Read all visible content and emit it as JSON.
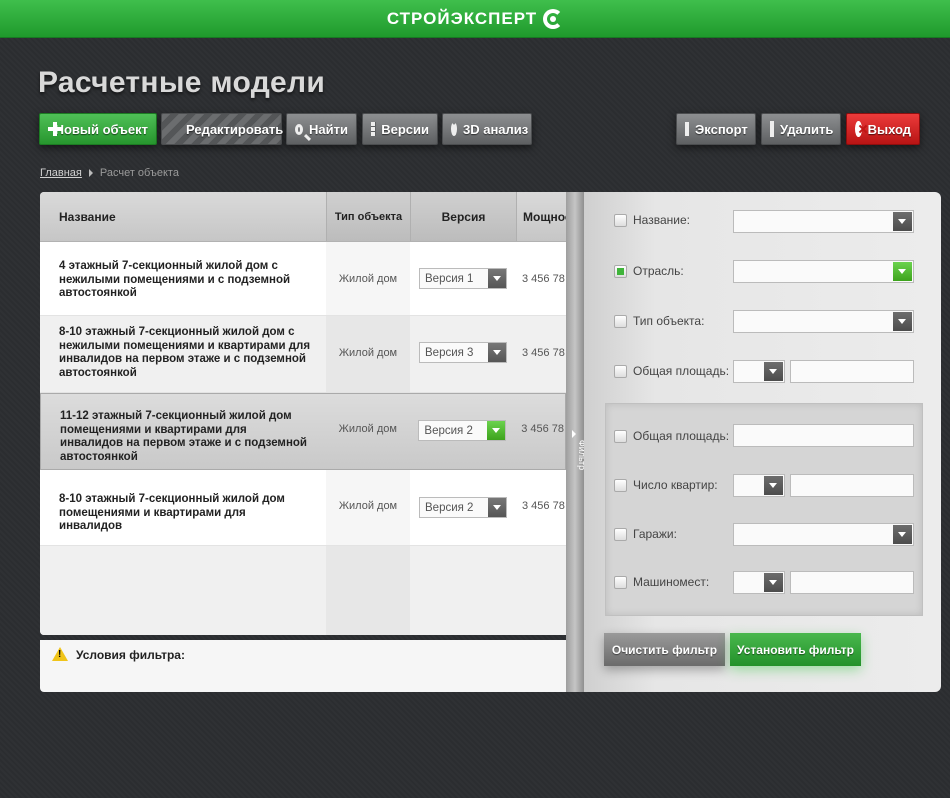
{
  "brand": {
    "name": "СТРОЙЭКСПЕРТ"
  },
  "page": {
    "title": "Расчетные модели"
  },
  "toolbar": {
    "new_object": "Новый объект",
    "edit": "Редактировать",
    "find": "Найти",
    "versions": "Версии",
    "analysis_3d": "3D анализ",
    "export": "Экспорт",
    "delete": "Удалить",
    "exit": "Выход"
  },
  "breadcrumb": {
    "home": "Главная",
    "current": "Расчет объекта"
  },
  "table": {
    "headers": {
      "name": "Название",
      "type": "Тип объекта",
      "version": "Версия",
      "power": "Мощнос"
    },
    "rows": [
      {
        "name": "4 этажный 7-секционный жилой дом с нежилыми помещениями и с подземной автостоянкой",
        "type": "Жилой дом",
        "version": "Версия 1",
        "power": "3 456 78"
      },
      {
        "name": "8-10 этажный 7-секционный жилой дом с нежилыми помещениями и квартирами для инвалидов на первом этаже и с подземной автостоянкой",
        "type": "Жилой дом",
        "version": "Версия 3",
        "power": "3 456 78"
      },
      {
        "name": "11-12 этажный 7-секционный жилой дом помещениями и квартирами для инвалидов на первом этаже и с подземной автостоянкой",
        "type": "Жилой дом",
        "version": "Версия 2",
        "power": "3 456 78"
      },
      {
        "name": "8-10 этажный 7-секционный жилой дом помещениями и квартирами для инвалидов",
        "type": "Жилой дом",
        "version": "Версия 2",
        "power": "3 456 78"
      }
    ]
  },
  "filter_conditions": {
    "label": "Условия фильтра:"
  },
  "divider": {
    "label": "Фильтр"
  },
  "filter": {
    "name": "Название:",
    "industry": "Отрасль:",
    "object_type": "Тип объекта:",
    "total_area": "Общая площадь:",
    "group_total_area": "Общая площадь:",
    "apartments": "Число квартир:",
    "garages": "Гаражи:",
    "parking": "Машиномест:",
    "clear_button": "Очистить фильтр",
    "apply_button": "Установить фильтр"
  },
  "colors": {
    "accent_green": "#27962e",
    "danger_red": "#c01616"
  }
}
